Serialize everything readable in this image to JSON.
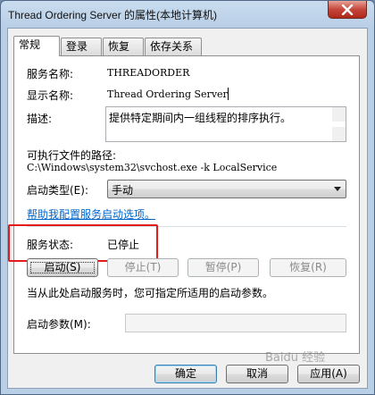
{
  "window": {
    "title": "Thread Ordering Server 的属性(本地计算机)"
  },
  "tabs": [
    {
      "label": "常规"
    },
    {
      "label": "登录"
    },
    {
      "label": "恢复"
    },
    {
      "label": "依存关系"
    }
  ],
  "general": {
    "service_name_label": "服务名称:",
    "service_name_value": "THREADORDER",
    "display_name_label": "显示名称:",
    "display_name_value": "Thread Ordering Server",
    "description_label": "描述:",
    "description_value": "提供特定期间内一组线程的排序执行。",
    "exe_path_label": "可执行文件的路径:",
    "exe_path_value": "C:\\Windows\\system32\\svchost.exe -k LocalService",
    "startup_type_label": "启动类型(E):",
    "startup_type_value": "手动",
    "help_link": "帮助我配置服务启动选项。",
    "status_label": "服务状态:",
    "status_value": "已停止",
    "buttons": {
      "start": "启动(S)",
      "stop": "停止(T)",
      "pause": "暂停(P)",
      "resume": "恢复(R)"
    },
    "hint_text": "当从此处启动服务时，您可指定所适用的启动参数。",
    "start_params_label": "启动参数(M):",
    "start_params_value": ""
  },
  "footer": {
    "ok": "确定",
    "cancel": "取消",
    "apply": "应用(A)"
  },
  "watermark": "Baidu 经验"
}
